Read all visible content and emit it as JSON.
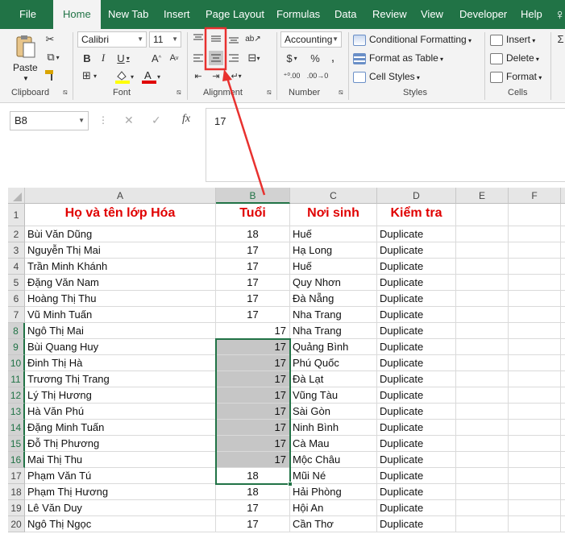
{
  "tabs": [
    "File",
    "Home",
    "New Tab",
    "Insert",
    "Page Layout",
    "Formulas",
    "Data",
    "Review",
    "View",
    "Developer",
    "Help"
  ],
  "ribbon": {
    "paste": "Paste",
    "font_name": "Calibri",
    "font_size": "11",
    "number_format": "Accounting",
    "conditional_formatting": "Conditional Formatting",
    "format_as_table": "Format as Table",
    "cell_styles": "Cell Styles",
    "insert": "Insert",
    "delete": "Delete",
    "format": "Format",
    "groups": {
      "clipboard": "Clipboard",
      "font": "Font",
      "alignment": "Alignment",
      "number": "Number",
      "styles": "Styles",
      "cells": "Cells"
    }
  },
  "formula_bar": {
    "name_box": "B8",
    "formula": "17",
    "fx": "fx"
  },
  "columns": [
    "A",
    "B",
    "C",
    "D",
    "E",
    "F"
  ],
  "rows": [
    {
      "n": "1",
      "a": "Họ và tên lớp Hóa",
      "b": "Tuổi",
      "c": "Nơi sinh",
      "d": "Kiểm tra"
    },
    {
      "n": "2",
      "a": "Bùi Văn Dũng",
      "b": "18",
      "c": "Huế",
      "d": "Duplicate"
    },
    {
      "n": "3",
      "a": "Nguyễn Thị Mai",
      "b": "17",
      "c": "Hạ Long",
      "d": "Duplicate"
    },
    {
      "n": "4",
      "a": "Trần Minh Khánh",
      "b": "17",
      "c": "Huế",
      "d": "Duplicate"
    },
    {
      "n": "5",
      "a": "Đặng Văn Nam",
      "b": "17",
      "c": "Quy Nhơn",
      "d": "Duplicate"
    },
    {
      "n": "6",
      "a": "Hoàng Thị Thu",
      "b": "17",
      "c": "Đà Nẵng",
      "d": "Duplicate"
    },
    {
      "n": "7",
      "a": "Vũ Minh Tuấn",
      "b": "17",
      "c": "Nha Trang",
      "d": "Duplicate"
    },
    {
      "n": "8",
      "a": "Ngô Thị Mai",
      "b": "17",
      "c": "Nha Trang",
      "d": "Duplicate"
    },
    {
      "n": "9",
      "a": "Bùi Quang Huy",
      "b": "17",
      "c": "Quảng Bình",
      "d": "Duplicate"
    },
    {
      "n": "10",
      "a": "Đinh Thị Hà",
      "b": "17",
      "c": "Phú Quốc",
      "d": "Duplicate"
    },
    {
      "n": "11",
      "a": "Trương Thị Trang",
      "b": "17",
      "c": "Đà Lạt",
      "d": "Duplicate"
    },
    {
      "n": "12",
      "a": "Lý Thị Hương",
      "b": "17",
      "c": "Vũng Tàu",
      "d": "Duplicate"
    },
    {
      "n": "13",
      "a": "Hà Văn Phú",
      "b": "17",
      "c": "Sài Gòn",
      "d": "Duplicate"
    },
    {
      "n": "14",
      "a": "Đặng Minh Tuấn",
      "b": "17",
      "c": "Ninh Bình",
      "d": "Duplicate"
    },
    {
      "n": "15",
      "a": "Đỗ Thị Phương",
      "b": "17",
      "c": "Cà Mau",
      "d": "Duplicate"
    },
    {
      "n": "16",
      "a": "Mai Thị Thu",
      "b": "17",
      "c": "Mộc Châu",
      "d": "Duplicate"
    },
    {
      "n": "17",
      "a": "Phạm Văn Tú",
      "b": "18",
      "c": "Mũi Né",
      "d": "Duplicate"
    },
    {
      "n": "18",
      "a": "Phạm Thị Hương",
      "b": "18",
      "c": "Hải Phòng",
      "d": "Duplicate"
    },
    {
      "n": "19",
      "a": "Lê Văn Duy",
      "b": "17",
      "c": "Hội An",
      "d": "Duplicate"
    },
    {
      "n": "20",
      "a": "Ngô Thị Ngọc",
      "b": "17",
      "c": "Cần Thơ",
      "d": "Duplicate"
    }
  ],
  "colors": {
    "excel_green": "#217346",
    "header_red": "#e00000",
    "annotation_red": "#e8312f",
    "selection_gray": "#c6c6c6"
  }
}
